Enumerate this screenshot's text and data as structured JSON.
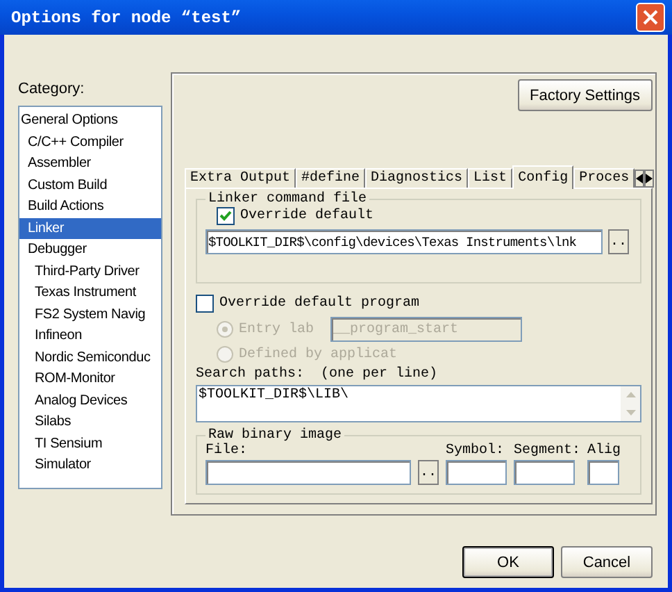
{
  "window": {
    "title": "Options for node “test”"
  },
  "factory_button": "Factory Settings",
  "category": {
    "label": "Category:",
    "items": [
      {
        "label": "General Options",
        "selected": false,
        "children": [
          {
            "label": "C/C++ Compiler",
            "selected": false
          },
          {
            "label": "Assembler",
            "selected": false
          },
          {
            "label": "Custom Build",
            "selected": false
          },
          {
            "label": "Build Actions",
            "selected": false
          },
          {
            "label": "Linker",
            "selected": true
          },
          {
            "label": "Debugger",
            "selected": false,
            "children": [
              {
                "label": "Third-Party Driver",
                "selected": false
              },
              {
                "label": "Texas Instrument",
                "selected": false
              },
              {
                "label": "FS2 System Navig",
                "selected": false
              },
              {
                "label": "Infineon",
                "selected": false
              },
              {
                "label": "Nordic Semiconduc",
                "selected": false
              },
              {
                "label": "ROM-Monitor",
                "selected": false
              },
              {
                "label": "Analog Devices",
                "selected": false
              },
              {
                "label": "Silabs",
                "selected": false
              },
              {
                "label": "TI Sensium",
                "selected": false
              },
              {
                "label": "Simulator",
                "selected": false
              }
            ]
          }
        ]
      }
    ]
  },
  "tabs": [
    {
      "label": "Extra Output",
      "selected": false
    },
    {
      "label": "#define",
      "selected": false
    },
    {
      "label": "Diagnostics",
      "selected": false
    },
    {
      "label": "List",
      "selected": false
    },
    {
      "label": "Config",
      "selected": true
    },
    {
      "label": "Proces",
      "selected": false
    }
  ],
  "linker_command_file": {
    "title": "Linker command file",
    "override": {
      "label": "Override default",
      "checked": true
    },
    "path": "$TOOLKIT_DIR$\\config\\devices\\Texas Instruments\\lnk",
    "browse": ".."
  },
  "override_program": {
    "label": "Override default program",
    "checked": false
  },
  "entry_options": [
    {
      "label": "Entry lab",
      "selected": true,
      "disabled": true,
      "value": "__program_start"
    },
    {
      "label": "Defined by applicat",
      "selected": false,
      "disabled": true
    }
  ],
  "search_paths": {
    "label": "Search paths:",
    "hint": "(one per line)",
    "value": "$TOOLKIT_DIR$\\LIB\\"
  },
  "raw_binary_image": {
    "title": "Raw binary image",
    "file_label": "File:",
    "browse": "..",
    "fields": [
      "Symbol:",
      "Segment:",
      "Alig"
    ]
  },
  "buttons": [
    {
      "label": "OK",
      "default": true
    },
    {
      "label": "Cancel",
      "default": false
    }
  ]
}
